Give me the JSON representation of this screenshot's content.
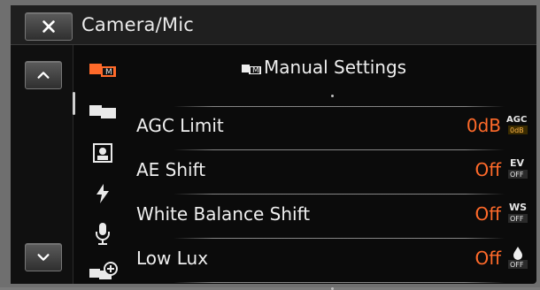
{
  "window": {
    "title": "Camera/Mic"
  },
  "nav": {
    "close_label": "close",
    "up_label": "up",
    "down_label": "down"
  },
  "section": {
    "title": "Manual Settings"
  },
  "items": [
    {
      "name": "AGC Limit",
      "value": "0dB",
      "icon_top": "AGC",
      "icon_bottom": "0dB",
      "icon": "agc-limit-icon"
    },
    {
      "name": "AE Shift",
      "value": "Off",
      "icon_top": "EV",
      "icon_bottom": "OFF",
      "icon": "ae-shift-icon"
    },
    {
      "name": "White Balance Shift",
      "value": "Off",
      "icon_top": "WS",
      "icon_bottom": "OFF",
      "icon": "white-balance-shift-icon"
    },
    {
      "name": "Low Lux",
      "value": "Off",
      "icon_top": "",
      "icon_bottom": "OFF",
      "icon": "low-lux-icon"
    }
  ],
  "colors": {
    "accent": "#ff6a2a",
    "panel": "#0b0b0b"
  }
}
